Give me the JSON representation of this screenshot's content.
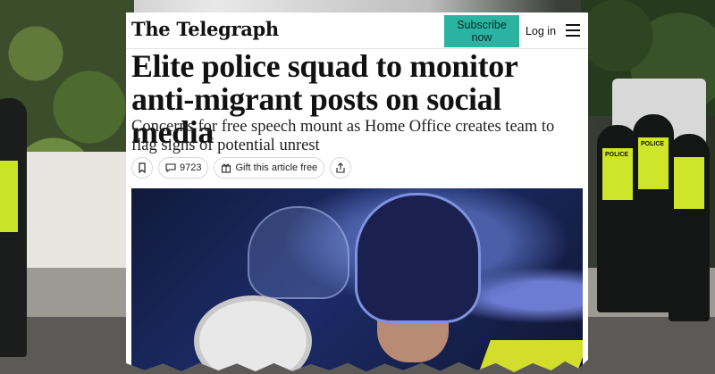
{
  "site": {
    "logo": "The Telegraph",
    "subscribe_label": "Subscribe now",
    "login_label": "Log in",
    "menu_icon": "hamburger-menu-icon"
  },
  "article": {
    "headline": "Elite police squad to monitor anti-migrant posts on social media",
    "standfirst": "Concerns for free speech mount as Home Office creates team to flag signs of potential unrest",
    "actions": {
      "bookmark_icon": "bookmark-icon",
      "comments_icon": "comment-icon",
      "comments_count": "9723",
      "gift_icon": "gift-icon",
      "gift_label": "Gift this article free",
      "share_icon": "share-icon"
    }
  },
  "background": {
    "vest_label": "POLICE"
  },
  "colors": {
    "subscribe_bg": "#2ab3a1",
    "hi_vis": "#cfe52a"
  }
}
